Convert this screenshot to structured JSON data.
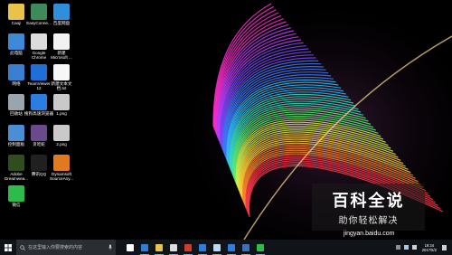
{
  "desktop_icons": [
    {
      "name": "icon-caoji",
      "label": "Caoji",
      "label2": "",
      "icon": "folder-user-icon",
      "color": "#e8c34a"
    },
    {
      "name": "icon-easyconnect",
      "label": "EasyConne...",
      "label2": "",
      "icon": "easyconnect-icon",
      "color": "#3d8a5a"
    },
    {
      "name": "icon-baidu-netdisk",
      "label": "百度网盘",
      "label2": "",
      "icon": "cloud-icon",
      "color": "#2f8fdb"
    },
    {
      "name": "icon-this-pc",
      "label": "此电脑",
      "label2": "",
      "icon": "computer-icon",
      "color": "#3c8ad8"
    },
    {
      "name": "icon-google-chrome",
      "label": "Google",
      "label2": "Chrome",
      "icon": "chrome-icon",
      "color": "#dddddd"
    },
    {
      "name": "icon-new-word",
      "label": "新建",
      "label2": "Microsoft ...",
      "icon": "document-icon",
      "color": "#f2f2f2"
    },
    {
      "name": "icon-network",
      "label": "网络",
      "label2": "",
      "icon": "globe-icon",
      "color": "#3a7fd1"
    },
    {
      "name": "icon-teamviewer",
      "label": "TeamViewer",
      "label2": "12",
      "icon": "teamviewer-icon",
      "color": "#1f6fd6"
    },
    {
      "name": "icon-new-text",
      "label": "新建文本文",
      "label2": "档.txt",
      "icon": "text-file-icon",
      "color": "#f7f7f7"
    },
    {
      "name": "icon-recycle-bin",
      "label": "回收站",
      "label2": "",
      "icon": "recycle-bin-icon",
      "color": "#9aa4ad"
    },
    {
      "name": "icon-sogou-browser",
      "label": "搜狗高速浏览器",
      "label2": "",
      "icon": "browser-icon",
      "color": "#2b7de0"
    },
    {
      "name": "icon-1png",
      "label": "1.png",
      "label2": "",
      "icon": "image-file-icon",
      "color": "#c9c9c9"
    },
    {
      "name": "icon-control-panel",
      "label": "控制面板",
      "label2": "",
      "icon": "control-panel-icon",
      "color": "#4a8fd6"
    },
    {
      "name": "icon-snake",
      "label": "贪吃蛇",
      "label2": "",
      "icon": "game-icon",
      "color": "#6a4a8a"
    },
    {
      "name": "icon-2png",
      "label": "2.png",
      "label2": "",
      "icon": "image-file-icon",
      "color": "#c9c9c9"
    },
    {
      "name": "icon-dreamweaver",
      "label": "Adobe",
      "label2": "Dreamwea...",
      "icon": "dreamweaver-icon",
      "color": "#2f4d1f"
    },
    {
      "name": "icon-tencent-qq",
      "label": "腾讯QQ",
      "label2": "",
      "icon": "qq-icon",
      "color": "#202020"
    },
    {
      "name": "icon-dynamsoft",
      "label": "Dynamsoft",
      "label2": "SourceAny...",
      "icon": "dynamsoft-icon",
      "color": "#e07a1f"
    },
    {
      "name": "icon-wechat",
      "label": "微信",
      "label2": "",
      "icon": "wechat-icon",
      "color": "#2dbb4a"
    }
  ],
  "taskbar": {
    "search_placeholder": "在这里输入你要搜索的内容",
    "apps": [
      {
        "name": "taskbar-task-view",
        "icon": "task-view-icon",
        "color": "#ffffff"
      },
      {
        "name": "taskbar-edge",
        "icon": "edge-icon",
        "color": "#2d7fd6"
      },
      {
        "name": "taskbar-explorer",
        "icon": "folder-icon",
        "color": "#e8c34a"
      },
      {
        "name": "taskbar-chrome",
        "icon": "chrome-icon",
        "color": "#dddddd"
      },
      {
        "name": "taskbar-app-red",
        "icon": "app-icon",
        "color": "#d23a2a"
      },
      {
        "name": "taskbar-ie",
        "icon": "ie-icon",
        "color": "#2b7de0"
      },
      {
        "name": "taskbar-notepad",
        "icon": "notepad-icon",
        "color": "#bcd8f0"
      },
      {
        "name": "taskbar-sogou",
        "icon": "browser-icon",
        "color": "#2b7de0"
      },
      {
        "name": "taskbar-app-blue",
        "icon": "app-icon",
        "color": "#3f6fb8"
      },
      {
        "name": "taskbar-wechat",
        "icon": "wechat-icon",
        "color": "#2dbb4a"
      }
    ],
    "clock_time": "19:34",
    "clock_date": "2017/5/2"
  },
  "watermark": {
    "title": "百科全说",
    "subtitle": "助你轻松解决",
    "url": "jingyan.baidu.com"
  }
}
